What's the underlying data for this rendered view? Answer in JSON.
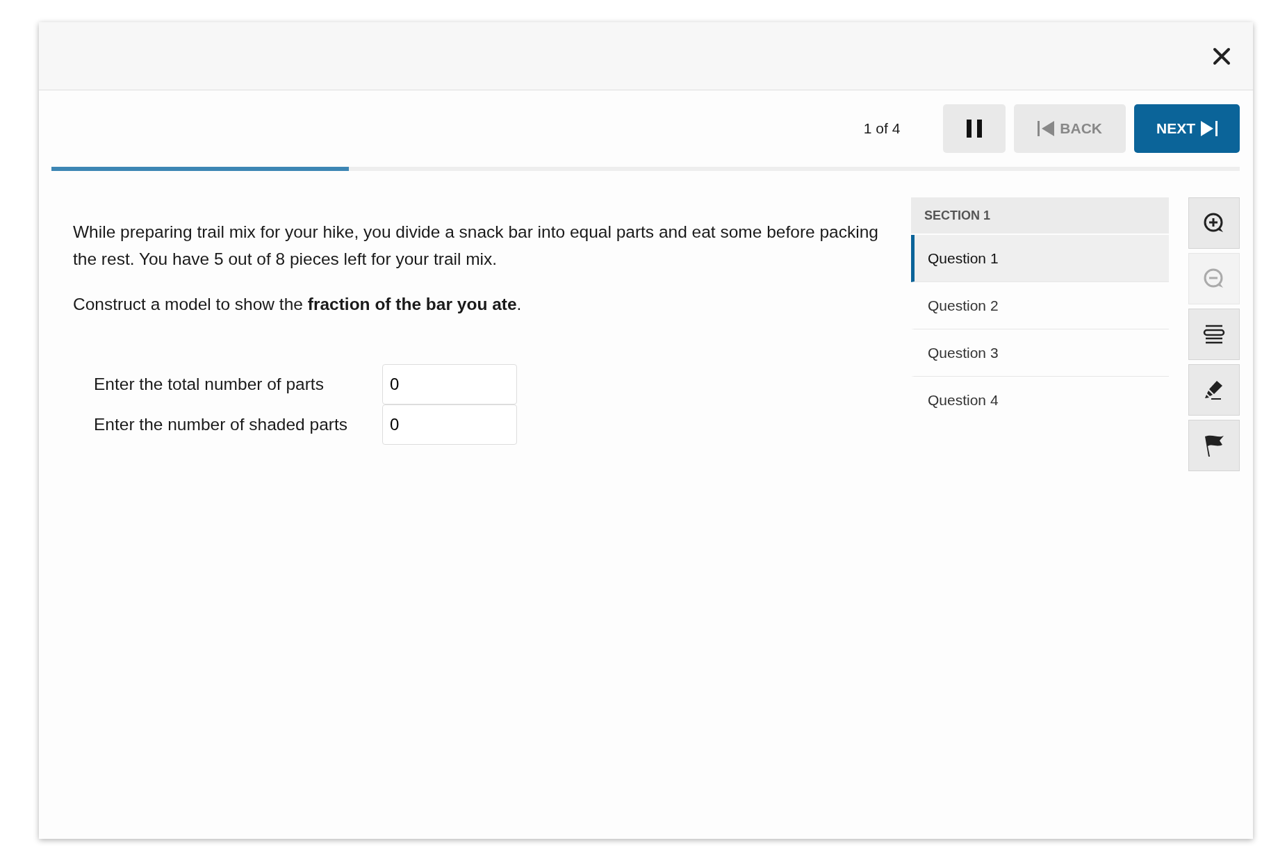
{
  "toolbar": {
    "position": "1 of 4",
    "buttons": [
      {
        "kind": "pause",
        "disabled": false
      },
      {
        "kind": "back",
        "label": "BACK",
        "disabled": true
      },
      {
        "kind": "next",
        "label": "NEXT",
        "disabled": false
      }
    ]
  },
  "progress": {
    "level": 0.25
  },
  "question": {
    "paragraphs": [
      "While preparing trail mix for your hike, you divide a snack bar into equal parts and eat some before packing the rest. You have 5 out of 8 pieces left for your trail mix.",
      "Construct a model to show the **fraction of the bar you ate**."
    ],
    "fields": [
      {
        "label": "Enter the total number of parts",
        "value": "0"
      },
      {
        "label": "Enter the number of shaded parts",
        "value": "0"
      }
    ]
  },
  "sidebar": {
    "section": "SECTION 1",
    "items": [
      {
        "label": "Question 1",
        "selected": true
      },
      {
        "label": "Question 2",
        "selected": false
      },
      {
        "label": "Question 3",
        "selected": false
      },
      {
        "label": "Question 4",
        "selected": false
      }
    ]
  },
  "tools": [
    {
      "kind": "zoom-in",
      "disabled": false
    },
    {
      "kind": "zoom-out",
      "disabled": true
    },
    {
      "kind": "line-reader",
      "disabled": false
    },
    {
      "kind": "highlighter",
      "disabled": false
    },
    {
      "kind": "flag",
      "disabled": false
    }
  ]
}
